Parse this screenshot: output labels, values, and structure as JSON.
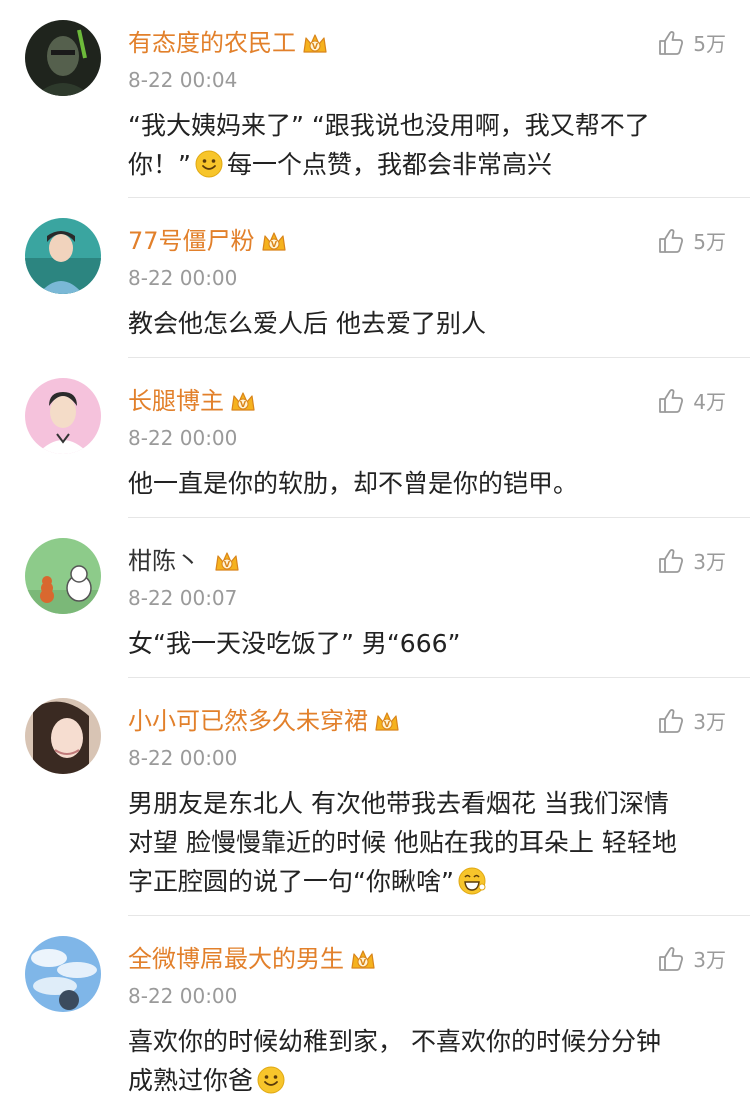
{
  "comments": [
    {
      "username": "有态度的农民工",
      "time": "8-22 00:04",
      "likes": "5万",
      "text_a": "“我大姨妈来了” “跟我说也没用啊，我又帮不了",
      "text_b": "你！”",
      "text_c": "每一个点赞，我都会非常高兴"
    },
    {
      "username": "77号僵尸粉",
      "time": "8-22 00:00",
      "likes": "5万",
      "text_a": "教会他怎么爱人后  他去爱了别人"
    },
    {
      "username": "长腿博主",
      "time": "8-22 00:00",
      "likes": "4万",
      "text_a": "他一直是你的软肋，却不曾是你的铠甲。"
    },
    {
      "username": "柑陈丶",
      "time": "8-22 00:07",
      "likes": "3万",
      "text_a": "女“我一天没吃饭了” 男“666”"
    },
    {
      "username": "小小可已然多久未穿裙",
      "time": "8-22 00:00",
      "likes": "3万",
      "text_a": "男朋友是东北人 有次他带我去看烟花 当我们深情",
      "text_b": "对望 脸慢慢靠近的时候 他贴在我的耳朵上 轻轻地",
      "text_c": "字正腔圆的说了一句“你瞅啥”"
    },
    {
      "username": "全微博屌最大的男生",
      "time": "8-22 00:00",
      "likes": "3万",
      "text_a": "喜欢你的时候幼稚到家，  不喜欢你的时候分分钟",
      "text_b": "成熟过你爸"
    }
  ],
  "icons": {
    "like": "thumb-up-icon",
    "badge": "vip-crown-badge-icon",
    "smile": "smile-emoji-icon",
    "grin": "grin-emoji-icon"
  },
  "colors": {
    "vip_name": "#e2802b",
    "plain_name": "#333333",
    "meta": "#9a9a9a",
    "divider": "#e6e6e6",
    "emoji": "#f7c52b"
  }
}
